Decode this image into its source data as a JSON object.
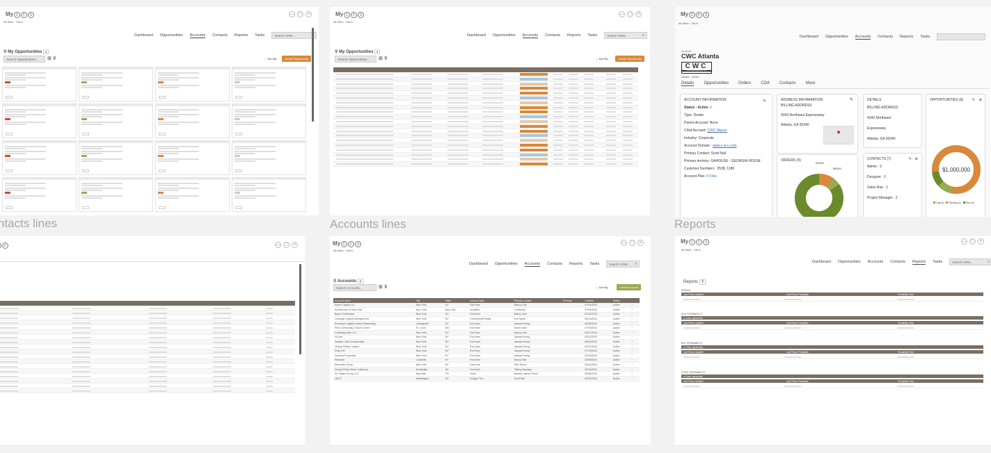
{
  "boards": {
    "contacts": {
      "label": "ntacts lines"
    },
    "accounts": {
      "label": "Accounts lines"
    },
    "reports": {
      "label": "Reports"
    }
  },
  "app": {
    "logo": "My",
    "logo_letters": [
      "C",
      "F",
      "S"
    ],
    "winbtns": [
      "—",
      "□",
      "×"
    ],
    "crumb": "All Sites  ·  Ctrl-K",
    "nav": [
      "Dashboard",
      "Opportunities",
      "Accounts",
      "Contacts",
      "Reports",
      "Tasks"
    ],
    "search_placeholder": "Search CRM...",
    "search_icon": "magnifier-icon"
  },
  "opps": {
    "title": "My Opportunities",
    "search_placeholder": "Search Opportunities...",
    "sort": "Sort By",
    "create": "Create Opportunity"
  },
  "accounts_list": {
    "title": "Accounts",
    "search_placeholder": "Search Accounts...",
    "create": "Create Account",
    "columns": [
      "Account name",
      "City",
      "State",
      "Account type",
      "Primary contact",
      "Territory",
      "Created",
      "Status"
    ],
    "rows": [
      [
        "Acorn Capital LLC",
        "New York",
        "NY",
        "End User",
        "Nancy Cole",
        "",
        "07/19/2024",
        "Active"
      ],
      [
        "Architecture of New York",
        "New York",
        "New York",
        "Architect",
        "Lil Barney",
        "",
        "07/04/2024",
        "Active"
      ],
      [
        "Banco Goldmans",
        "New York",
        "NY",
        "End User",
        "Nancy Cole",
        "",
        "02/11/2024",
        "Active"
      ],
      [
        "Carnegie Capital Management",
        "New York",
        "NY",
        "Commercial Realty",
        "Lee Spark",
        "",
        "05/14/2024",
        "Active"
      ],
      [
        "Envelope Capital Limited Partnership",
        "Collegeville",
        "NY",
        "End User",
        "Jamaal Kenny",
        "",
        "06/28/2024",
        "Active"
      ],
      [
        "First Community Church Center",
        "St. Louis",
        "MO",
        "End User",
        "Elaine Alvin",
        "",
        "07/04/2024",
        "Active"
      ],
      [
        "GoDaddy Web LLC",
        "New York",
        "NY",
        "End User",
        "Nancy Cole",
        "",
        "03/07/2024",
        "Active"
      ],
      [
        "Hi-Line",
        "New York",
        "NY",
        "End User",
        "Jamaal Kenny",
        "",
        "02/21/2024",
        "Active"
      ],
      [
        "Hudson Lofts & Associates",
        "New York",
        "NY",
        "End User",
        "Jamaal Kenny",
        "",
        "05/02/2024",
        "Active"
      ],
      [
        "Jersey Plastic Holders",
        "New York",
        "NY",
        "End User",
        "Jamaal Kenny",
        "",
        "02/07/2024",
        "Active"
      ],
      [
        "Krisp NG",
        "New York",
        "NY",
        "End User",
        "Jamaal Kenny",
        "",
        "07/19/2024",
        "Active"
      ],
      [
        "Orchard Properties",
        "New York",
        "NY",
        "End User",
        "Jamaal Kenny",
        "",
        "02/19/2024",
        "Active"
      ],
      [
        "Parancer",
        "Louisville",
        "KY",
        "End User",
        "Nancy Tate",
        "",
        "03/06/2024",
        "Active"
      ],
      [
        "Riverside Group",
        "New York",
        "NY",
        "Dual Use",
        "Rob Turner",
        "",
        "04/04/2024",
        "Active"
      ],
      [
        "Schaul Public Work Collection",
        "Scottsdale",
        "AZ",
        "End User",
        "Tiffany Buening",
        "",
        "06/15/2024",
        "Active"
      ],
      [
        "St. Rafael Group LLC",
        "Nashville",
        "TN",
        "Hotel",
        "Bradley Jacob Prince",
        "",
        "05/06/2024",
        "Active"
      ],
      [
        "UNITT",
        "Washington",
        "DC",
        "Design Firm",
        "Scott Nolf",
        "",
        "03/22/2024",
        "Active"
      ]
    ]
  },
  "account": {
    "breadcrumb": "Accounts",
    "name": "CWC Atlanta",
    "logo_text": "CWC",
    "logo_sub": "Office Furnishings Since 1924",
    "logo_tags": [
      "Dealer",
      "Active"
    ],
    "tabs": [
      "Details",
      "Opportunities",
      "Orders",
      "CDA",
      "Contacts",
      "More"
    ],
    "info": {
      "header": "ACCOUNT INFORMATION",
      "status": "Status : Active",
      "type": "Type: Dealer",
      "parent": "Parent Account: None",
      "child_label": "Child Account:",
      "child": "CWC Macon",
      "industry": "Industry: Corporate",
      "domain_label": "Account Domain :",
      "domain": "www.c-w-c.com",
      "primary": "Primary Contact: Scott Nall",
      "territory": "Primary territory: GAHOUSE - GEORGIA HOUSE",
      "customer": "Customer Numbers : 2538, 1186",
      "plan_label": "Account Plan:",
      "plan": "0 Files"
    },
    "address": {
      "header": "ADDRESS INFORMATION",
      "billing": "BILLING ADDRESS",
      "street": "4343 Northeast Expressway",
      "city": "Atlanta, GA 30340"
    },
    "details": {
      "header": "DETAILS",
      "billing": "BILLING ADDRESS",
      "l1": "4343 Northeast",
      "l2": "Expressway",
      "l3": "Atlanta, GA 30340"
    },
    "orders": {
      "header": "ORDERS (5)",
      "label1": "$10000",
      "label2": "$80000"
    },
    "contacts": {
      "header": "CONTACTS (7)",
      "items": [
        "Admin : 2",
        "Designer : 2",
        "Sales Rep : 1",
        "Project Manager : 2"
      ]
    },
    "opps": {
      "header": "OPPORTUNITIES (6)",
      "total": "$1,000,000",
      "legend": [
        "Lost (4)",
        "Pending (1)",
        "Won (1)"
      ]
    }
  },
  "reports": {
    "title": "Reports",
    "sections": [
      "PATROL",
      "SKU PROBABILITY",
      "BOL PROBABILITY",
      "TOTAL PROBABILITY"
    ],
    "bar": "Total: opportunity",
    "cols": [
      "Last Prices Updated",
      "Last Prices Probability",
      "Probability Total"
    ]
  },
  "colors": {
    "accent": "#d8893b",
    "olive": "#6b8a2c",
    "table_header": "#7a6e62"
  }
}
